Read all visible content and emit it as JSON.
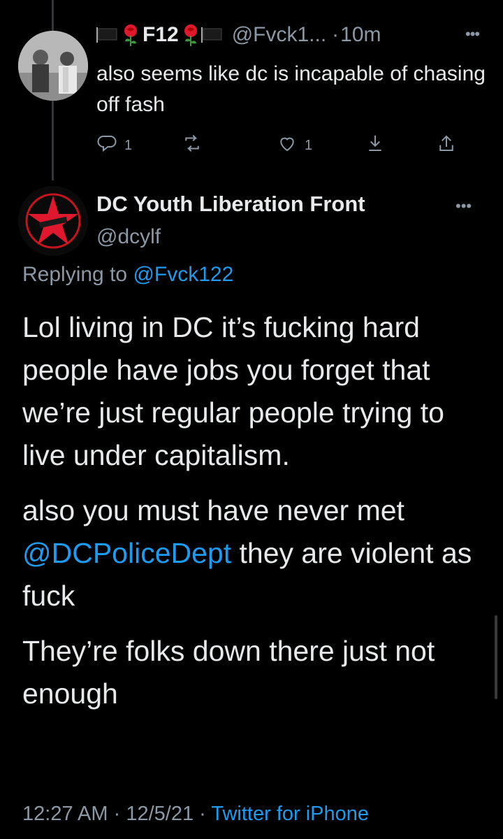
{
  "reply_tweet": {
    "display_name": "F12",
    "handle": "@Fvck1...",
    "separator": "·",
    "time": "10m",
    "text": "also seems like dc is incapable of chasing off fash",
    "reply_count": "1",
    "retweet_count": "",
    "like_count": "1"
  },
  "main_tweet": {
    "display_name": "DC Youth Liberation Front",
    "handle": "@dcylf",
    "replying_prefix": "Replying to",
    "replying_to": "@Fvck122",
    "paragraph1": "Lol living in DC it’s fucking hard people have jobs you forget that we’re just regular people trying to live under capitalism.",
    "paragraph2_mention": "@DCPoliceDept",
    "paragraph2_before": "also you must have never met ",
    "paragraph2_after": " they are violent as fuck",
    "paragraph3": "They’re folks down there just not enough",
    "time": "12:27 AM",
    "date": "12/5/21",
    "meta_separator": "·",
    "source": "Twitter for iPhone"
  },
  "icons": [
    "flag-icon",
    "rose-icon",
    "more-icon",
    "reply-icon",
    "retweet-icon",
    "like-icon",
    "bookmark-icon",
    "share-icon"
  ],
  "colors": {
    "background": "#000000",
    "text": "#e7e9ea",
    "secondary": "#8b98a5",
    "link": "#1d9bf0",
    "accent_red": "#e0182d"
  }
}
